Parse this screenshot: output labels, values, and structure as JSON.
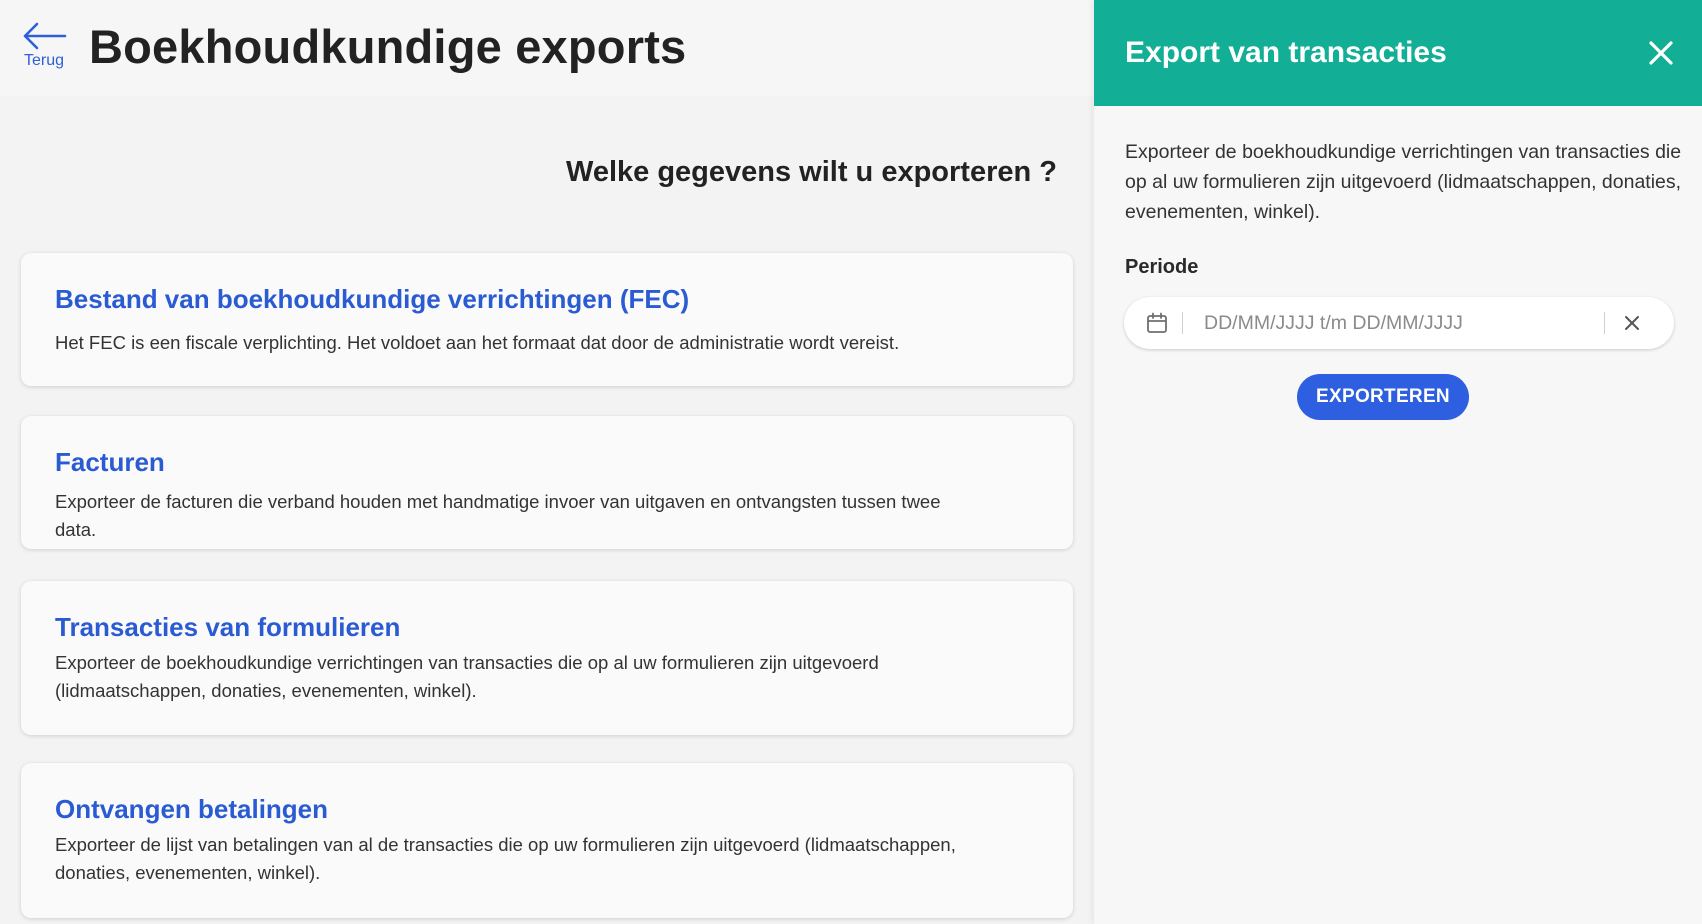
{
  "header": {
    "back_label": "Terug",
    "title": "Boekhoudkundige exports"
  },
  "main": {
    "question": "Welke gegevens wilt u exporteren ?",
    "cards": [
      {
        "title": "Bestand van boekhoudkundige verrichtingen (FEC)",
        "description": "Het FEC is een fiscale verplichting. Het voldoet aan het formaat dat door de administratie wordt vereist."
      },
      {
        "title": "Facturen",
        "description": "Exporteer de facturen die verband houden met handmatige invoer van uitgaven en ontvangsten tussen twee data."
      },
      {
        "title": "Transacties van formulieren",
        "description": "Exporteer de boekhoudkundige verrichtingen van transacties die op al uw formulieren zijn uitgevoerd (lidmaatschappen, donaties, evenementen, winkel)."
      },
      {
        "title": "Ontvangen betalingen",
        "description": "Exporteer de lijst van betalingen van al de transacties die op uw formulieren zijn uitgevoerd (lidmaatschappen, donaties, evenementen, winkel)."
      }
    ]
  },
  "panel": {
    "title": "Export van transacties",
    "description": "Exporteer de boekhoudkundige verrichtingen van transacties die op al uw formulieren zijn uitgevoerd (lidmaatschappen, donaties, evenementen, winkel).",
    "period_label": "Periode",
    "date_range": {
      "value": "",
      "placeholder": "DD/MM/JJJJ t/m DD/MM/JJJJ"
    },
    "export_label": "EXPORTEREN"
  },
  "icons": {
    "back": "arrow-left-icon",
    "close": "close-icon",
    "calendar": "calendar-icon",
    "clear": "clear-icon"
  },
  "colors": {
    "accent_blue": "#2a5bd3",
    "button_blue": "#2e5fe0",
    "panel_header_teal": "#12ae95",
    "page_background": "#f3f3f3"
  }
}
